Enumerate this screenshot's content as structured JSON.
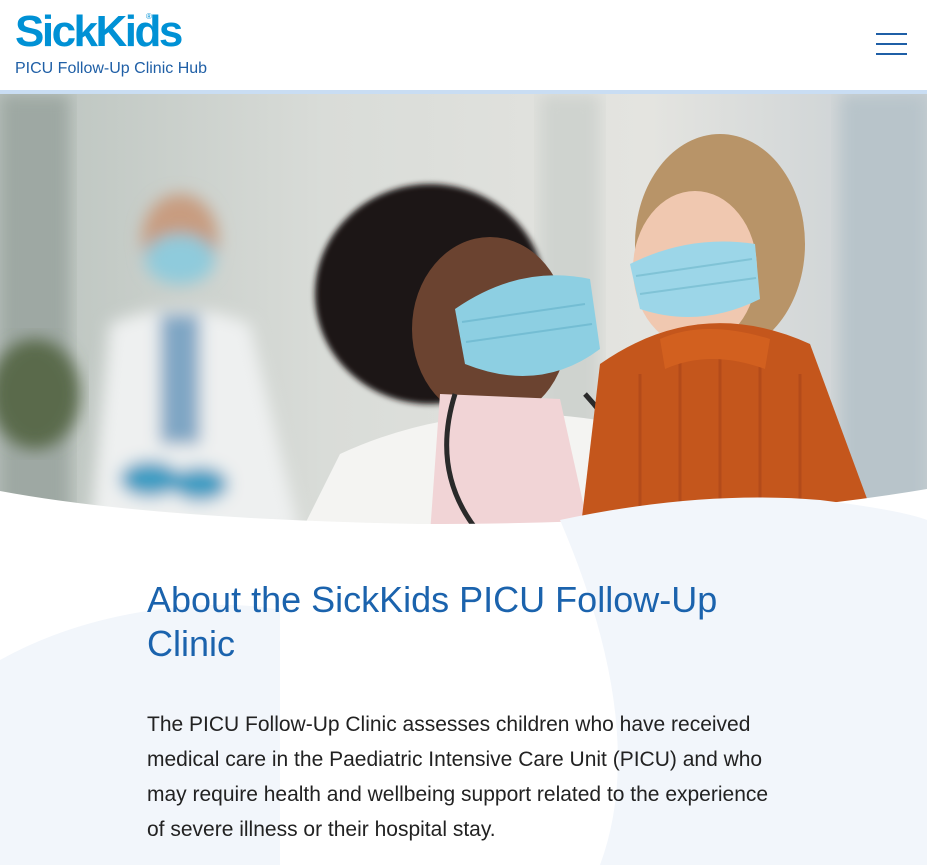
{
  "header": {
    "logo_text": "SickKids",
    "logo_mark": "®",
    "site_title": "PICU Follow-Up Clinic Hub",
    "menu_icon": "hamburger-menu-icon"
  },
  "hero": {
    "image": "photo of masked doctor holding a masked young girl in a hospital corridor"
  },
  "about": {
    "heading": "About the SickKids PICU Follow-Up Clinic",
    "body": "The PICU Follow-Up Clinic assesses children who have received medical care in the Paediatric Intensive Care Unit (PICU) and who may require health and wellbeing support related to the experience of severe illness or their hospital stay."
  },
  "colors": {
    "brand_blue": "#0091d5",
    "heading_blue": "#1b63ad",
    "nav_blue": "#1f5fa6",
    "header_rule": "#c9ddf3",
    "text": "#222222",
    "bg_wave": "#f2f6fb"
  }
}
